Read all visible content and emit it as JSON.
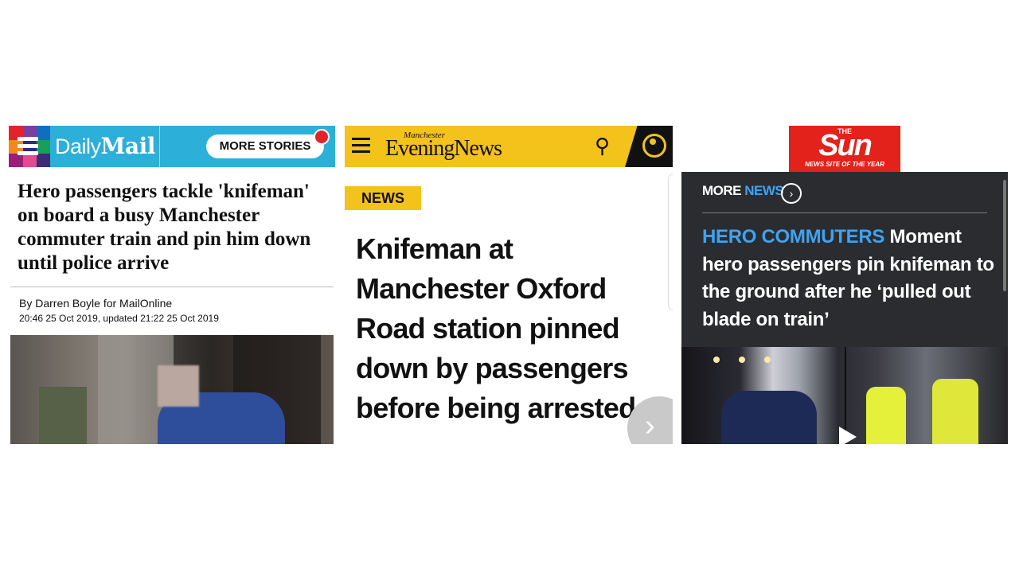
{
  "daily_mail": {
    "brand_prefix": "Daily",
    "brand_name": "Mail",
    "more_stories_label": "MORE STORIES",
    "headline": "Hero passengers tackle 'knifeman' on board a busy Manchester commuter train and pin him down until police arrive",
    "byline": "By Darren Boyle for MailOnline",
    "dates": "20:46 25 Oct 2019, updated 21:22 25 Oct 2019",
    "accent_color": "#2cafd8"
  },
  "men": {
    "brand_small": "Manchester",
    "brand": "EveningNews",
    "tag": "NEWS",
    "headline": "Knifeman at Manchester Oxford Road station pinned down by passengers before being arrested",
    "accent_color": "#f3c21b",
    "icons": [
      "menu-icon",
      "search-icon",
      "account-icon",
      "next-arrow-icon"
    ]
  },
  "sun": {
    "logo_the": "THE",
    "logo_name": "Sun",
    "logo_tagline": "NEWS SITE OF THE YEAR",
    "more_label": "MORE",
    "news_label": "NEWS",
    "kicker": "HERO COMMUTERS",
    "headline": "Moment hero passengers pin knifeman to the ground after he ‘pulled out blade on train’",
    "accent_color": "#3ea3f3",
    "brand_color": "#e2221b"
  }
}
